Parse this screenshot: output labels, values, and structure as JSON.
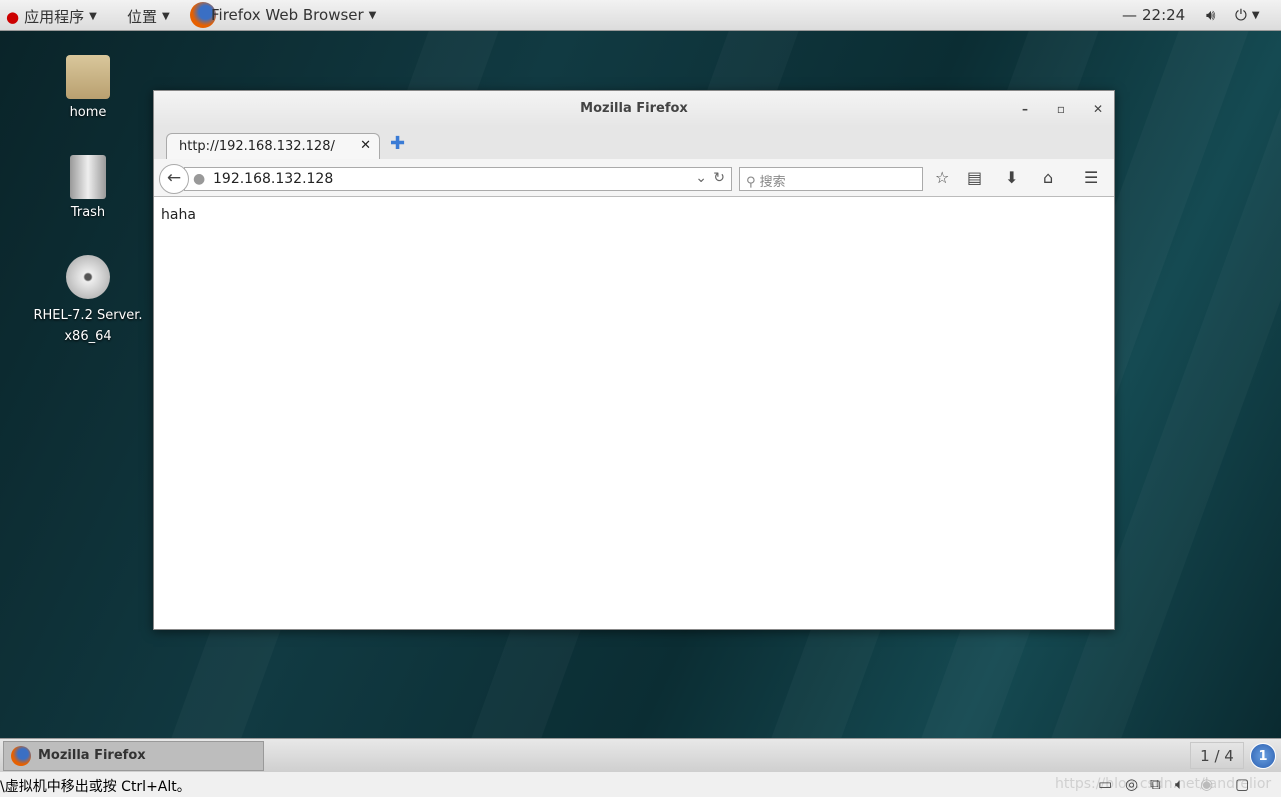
{
  "topbar": {
    "apps": "应用程序",
    "places": "位置",
    "active_app": "Firefox Web Browser",
    "clock": "22:24"
  },
  "desktop": {
    "icons": [
      {
        "label": "home"
      },
      {
        "label": "Trash"
      },
      {
        "label": "RHEL-7.2 Server.\nx86_64"
      }
    ]
  },
  "firefox": {
    "title": "Mozilla Firefox",
    "tab_title": "http://192.168.132.128/",
    "url": "192.168.132.128",
    "search_placeholder": "搜索",
    "page_text": "haha"
  },
  "taskbar": {
    "task_label": "Mozilla Firefox",
    "workspace": "1 / 4",
    "workspace_badge": "1"
  },
  "status": {
    "hint": "\\虚拟机中移出或按 Ctrl+Alt。",
    "watermark": "https://blog.csdn.net/landrelior"
  }
}
